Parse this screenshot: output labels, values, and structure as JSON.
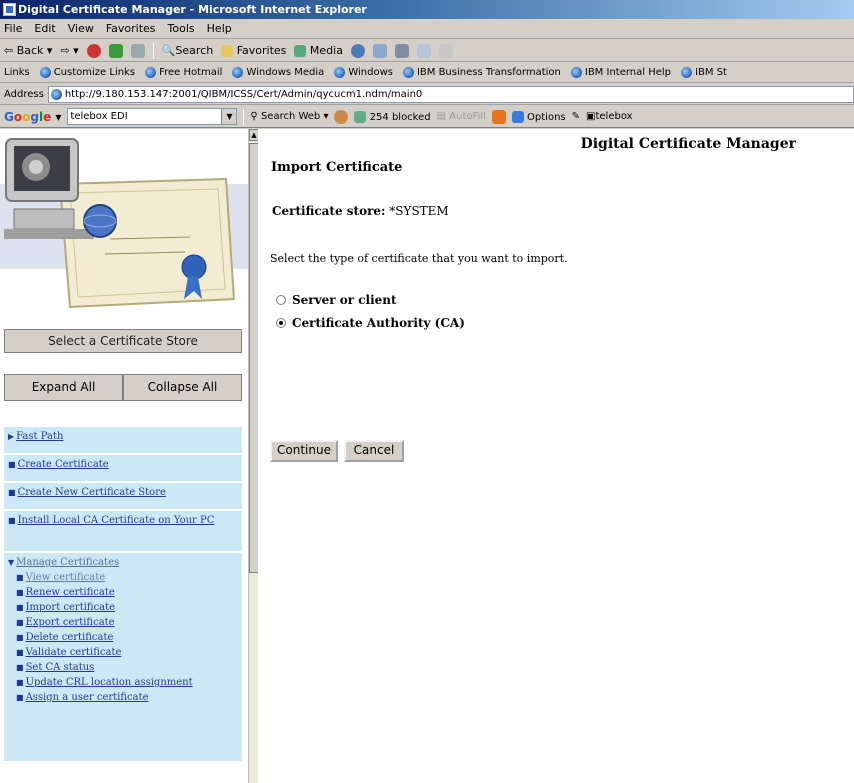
{
  "window": {
    "title": "Digital Certificate Manager - Microsoft Internet Explorer"
  },
  "menu": [
    "File",
    "Edit",
    "View",
    "Favorites",
    "Tools",
    "Help"
  ],
  "toolbar": {
    "back": "Back",
    "search": "Search",
    "favorites": "Favorites",
    "media": "Media"
  },
  "links": {
    "label": "Links",
    "items": [
      "Customize Links",
      "Free Hotmail",
      "Windows Media",
      "Windows",
      "IBM Business Transformation",
      "IBM Internal Help",
      "IBM St"
    ]
  },
  "address": {
    "label": "Address",
    "url": "http://9.180.153.147:2001/QIBM/ICSS/Cert/Admin/qycucm1.ndm/main0"
  },
  "googlebar": {
    "search_value": "telebox EDI",
    "search_web": "Search Web",
    "blocked": "254 blocked",
    "autofill": "AutoFill",
    "options": "Options",
    "telebox": "telebox"
  },
  "sidebar": {
    "store_button": "Select a Certificate Store",
    "expand_all": "Expand All",
    "collapse_all": "Collapse All",
    "items": [
      {
        "label": "Fast Path"
      },
      {
        "label": "Create Certificate"
      },
      {
        "label": "Create New Certificate Store"
      },
      {
        "label": "Install Local CA Certificate on Your PC"
      },
      {
        "label": "Manage Certificates"
      }
    ],
    "sub_items": [
      "View certificate",
      "Renew certificate",
      "Import certificate",
      "Export certificate",
      "Delete certificate",
      "Validate certificate",
      "Set CA status",
      "Update CRL location assignment",
      "Assign a user certificate"
    ]
  },
  "main": {
    "app_title": "Digital Certificate Manager",
    "heading": "Import Certificate",
    "store_label": "Certificate store:",
    "store_value": "*SYSTEM",
    "instruction": "Select the type of certificate that you want to import.",
    "options": [
      "Server or client",
      "Certificate Authority (CA)"
    ],
    "selected_option": "Certificate Authority (CA)",
    "continue_button": "Continue",
    "cancel_button": "Cancel"
  }
}
